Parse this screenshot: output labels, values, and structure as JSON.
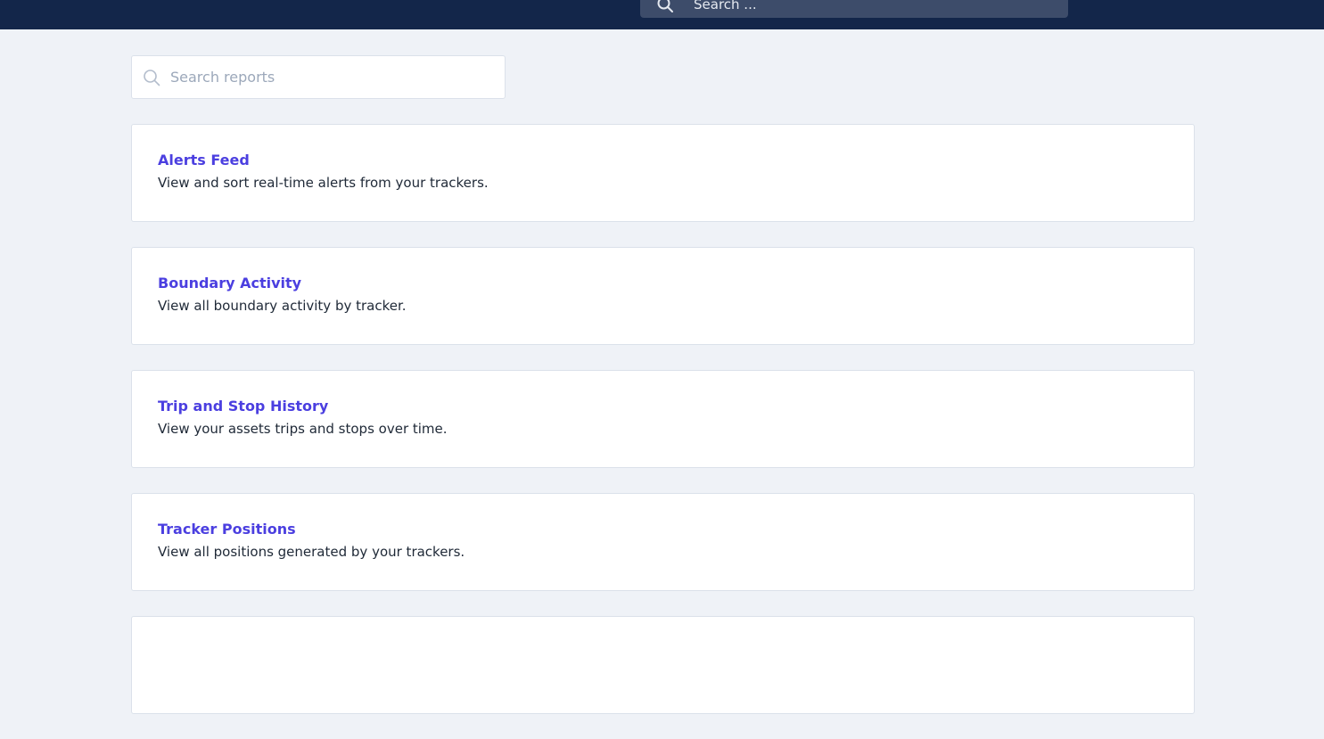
{
  "colors": {
    "topbar_bg": "#13264a",
    "page_bg": "#eff2f7",
    "link_accent": "#4b3fe0"
  },
  "header": {
    "search": {
      "placeholder": "Search ...",
      "icon": "search-icon"
    }
  },
  "main": {
    "search": {
      "placeholder": "Search reports",
      "value": "",
      "icon": "search-icon"
    },
    "reports": [
      {
        "title": "Alerts Feed",
        "description": "View and sort real-time alerts from your trackers."
      },
      {
        "title": "Boundary Activity",
        "description": "View all boundary activity by tracker."
      },
      {
        "title": "Trip and Stop History",
        "description": "View your assets trips and stops over time."
      },
      {
        "title": "Tracker Positions",
        "description": "View all positions generated by your trackers."
      },
      {
        "title": "",
        "description": ""
      }
    ]
  }
}
